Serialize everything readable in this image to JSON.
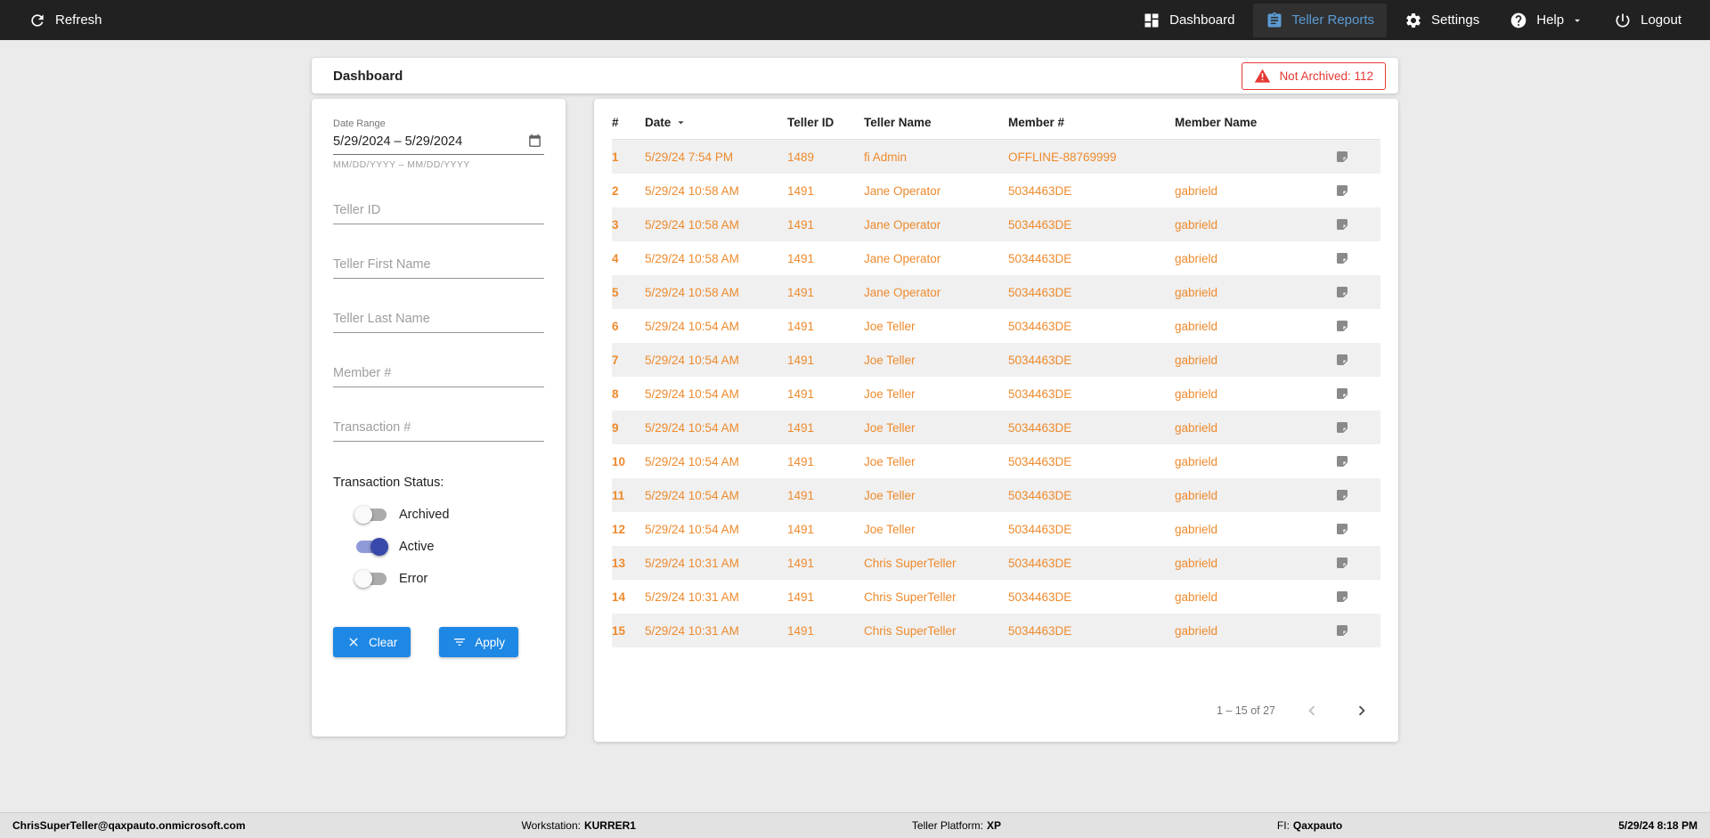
{
  "colors": {
    "accent_blue": "#1e88e5",
    "row_text_orange": "#ee8a2d",
    "alert_red": "#e53935",
    "nav_active_blue": "#5b9bd5",
    "toggle_on": "#3949ab",
    "toggle_on_track": "#8f9bd9"
  },
  "topbar": {
    "refresh_label": "Refresh",
    "nav": [
      {
        "label": "Dashboard"
      },
      {
        "label": "Teller Reports"
      },
      {
        "label": "Settings"
      },
      {
        "label": "Help"
      },
      {
        "label": "Logout"
      }
    ]
  },
  "header": {
    "title": "Dashboard",
    "not_archived_badge": "Not Archived: 112"
  },
  "filters": {
    "date_range_label": "Date Range",
    "date_range_value": "5/29/2024 – 5/29/2024",
    "date_range_helper": "MM/DD/YYYY – MM/DD/YYYY",
    "teller_id_placeholder": "Teller ID",
    "teller_first_name_placeholder": "Teller First Name",
    "teller_last_name_placeholder": "Teller Last Name",
    "member_number_placeholder": "Member #",
    "transaction_number_placeholder": "Transaction #",
    "status_label": "Transaction Status:",
    "toggles": [
      {
        "label": "Archived",
        "on": false
      },
      {
        "label": "Active",
        "on": true
      },
      {
        "label": "Error",
        "on": false
      }
    ],
    "clear_label": "Clear",
    "apply_label": "Apply"
  },
  "table": {
    "columns": [
      "#",
      "Date",
      "Teller ID",
      "Teller Name",
      "Member #",
      "Member Name"
    ],
    "rows": [
      {
        "num": "1",
        "date": "5/29/24 7:54 PM",
        "teller_id": "1489",
        "teller_name": "fi Admin",
        "member_num": "OFFLINE-88769999",
        "member_name": ""
      },
      {
        "num": "2",
        "date": "5/29/24 10:58 AM",
        "teller_id": "1491",
        "teller_name": "Jane Operator",
        "member_num": "5034463DE",
        "member_name": "gabrield"
      },
      {
        "num": "3",
        "date": "5/29/24 10:58 AM",
        "teller_id": "1491",
        "teller_name": "Jane Operator",
        "member_num": "5034463DE",
        "member_name": "gabrield"
      },
      {
        "num": "4",
        "date": "5/29/24 10:58 AM",
        "teller_id": "1491",
        "teller_name": "Jane Operator",
        "member_num": "5034463DE",
        "member_name": "gabrield"
      },
      {
        "num": "5",
        "date": "5/29/24 10:58 AM",
        "teller_id": "1491",
        "teller_name": "Jane Operator",
        "member_num": "5034463DE",
        "member_name": "gabrield"
      },
      {
        "num": "6",
        "date": "5/29/24 10:54 AM",
        "teller_id": "1491",
        "teller_name": "Joe Teller",
        "member_num": "5034463DE",
        "member_name": "gabrield"
      },
      {
        "num": "7",
        "date": "5/29/24 10:54 AM",
        "teller_id": "1491",
        "teller_name": "Joe Teller",
        "member_num": "5034463DE",
        "member_name": "gabrield"
      },
      {
        "num": "8",
        "date": "5/29/24 10:54 AM",
        "teller_id": "1491",
        "teller_name": "Joe Teller",
        "member_num": "5034463DE",
        "member_name": "gabrield"
      },
      {
        "num": "9",
        "date": "5/29/24 10:54 AM",
        "teller_id": "1491",
        "teller_name": "Joe Teller",
        "member_num": "5034463DE",
        "member_name": "gabrield"
      },
      {
        "num": "10",
        "date": "5/29/24 10:54 AM",
        "teller_id": "1491",
        "teller_name": "Joe Teller",
        "member_num": "5034463DE",
        "member_name": "gabrield"
      },
      {
        "num": "11",
        "date": "5/29/24 10:54 AM",
        "teller_id": "1491",
        "teller_name": "Joe Teller",
        "member_num": "5034463DE",
        "member_name": "gabrield"
      },
      {
        "num": "12",
        "date": "5/29/24 10:54 AM",
        "teller_id": "1491",
        "teller_name": "Joe Teller",
        "member_num": "5034463DE",
        "member_name": "gabrield"
      },
      {
        "num": "13",
        "date": "5/29/24 10:31 AM",
        "teller_id": "1491",
        "teller_name": "Chris SuperTeller",
        "member_num": "5034463DE",
        "member_name": "gabrield"
      },
      {
        "num": "14",
        "date": "5/29/24 10:31 AM",
        "teller_id": "1491",
        "teller_name": "Chris SuperTeller",
        "member_num": "5034463DE",
        "member_name": "gabrield"
      },
      {
        "num": "15",
        "date": "5/29/24 10:31 AM",
        "teller_id": "1491",
        "teller_name": "Chris SuperTeller",
        "member_num": "5034463DE",
        "member_name": "gabrield"
      }
    ],
    "pagination": {
      "range_label": "1 – 15 of 27"
    }
  },
  "footer": {
    "user": "ChrisSuperTeller@qaxpauto.onmicrosoft.com",
    "workstation_label": "Workstation:",
    "workstation_value": "KURRER1",
    "platform_label": "Teller Platform:",
    "platform_value": "XP",
    "fi_label": "FI:",
    "fi_value": "Qaxpauto",
    "datetime": "5/29/24 8:18 PM"
  }
}
